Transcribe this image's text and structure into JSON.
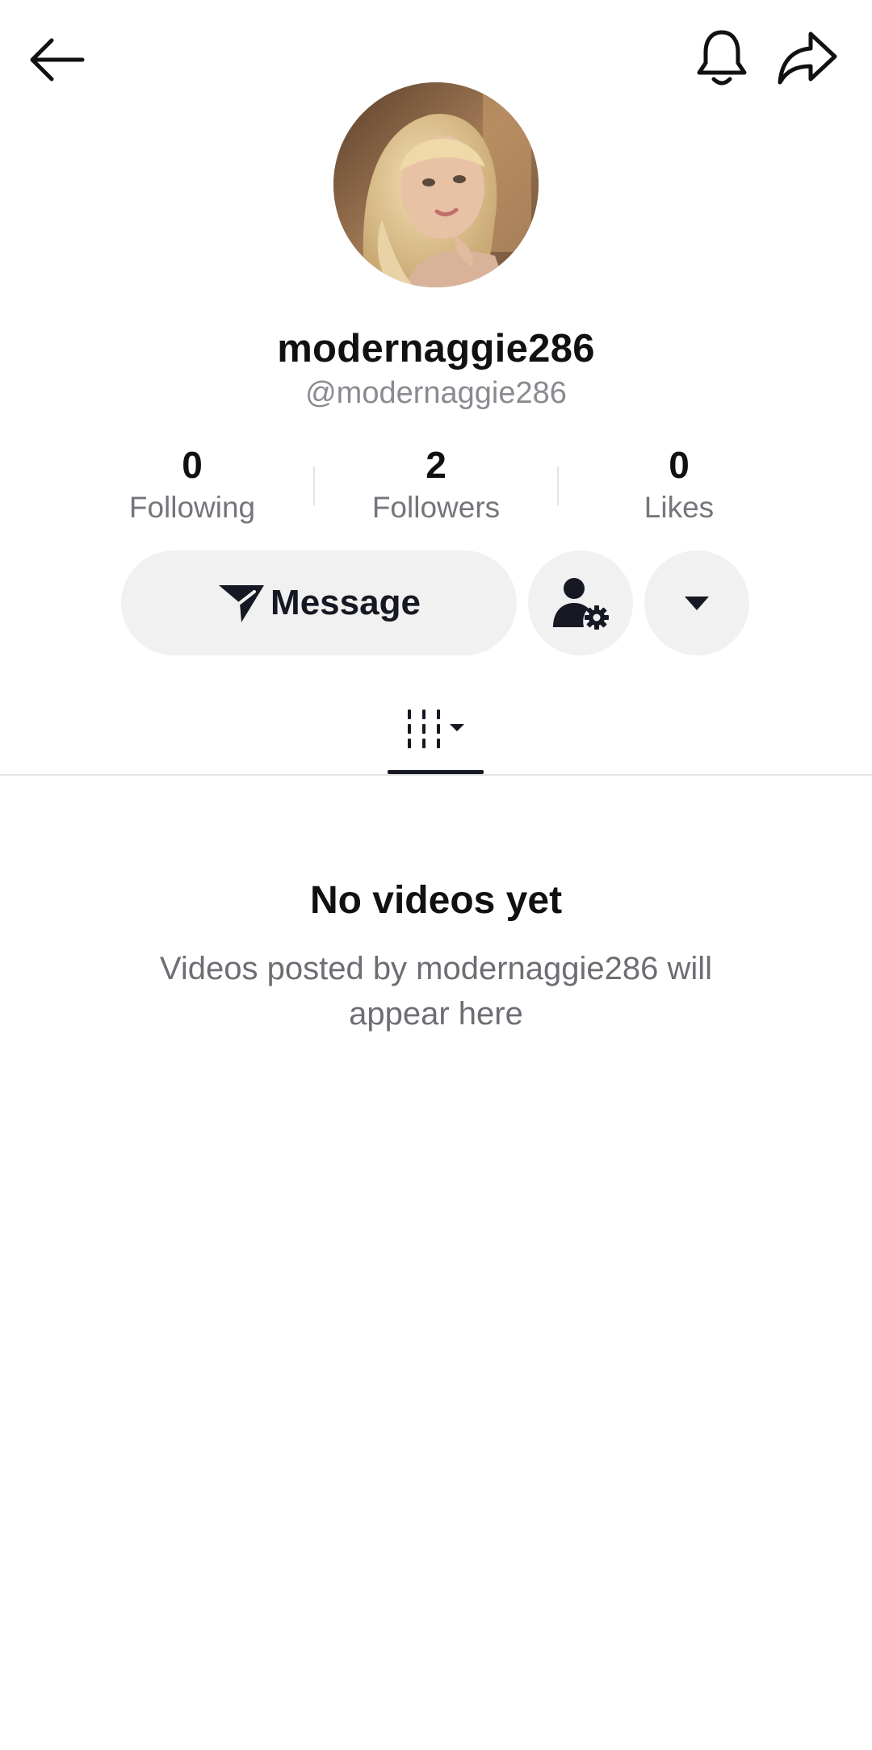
{
  "header": {
    "back_icon": "arrow-left-icon",
    "notification_icon": "bell-icon",
    "share_icon": "share-arrow-icon"
  },
  "profile": {
    "display_name": "modernaggie286",
    "handle": "@modernaggie286",
    "avatar": "profile-photo"
  },
  "stats": {
    "following": {
      "value": "0",
      "label": "Following"
    },
    "followers": {
      "value": "2",
      "label": "Followers"
    },
    "likes": {
      "value": "0",
      "label": "Likes"
    }
  },
  "actions": {
    "message_label": "Message",
    "message_icon": "send-icon",
    "friend_settings_icon": "person-gear-icon",
    "more_icon": "caret-down-icon"
  },
  "tabs": {
    "videos_icon": "grid-columns-icon"
  },
  "empty_state": {
    "title": "No videos yet",
    "description": "Videos posted by modernaggie286 will appear here"
  },
  "colors": {
    "text_primary": "#111111",
    "text_secondary": "#8a8b91",
    "button_bg": "#f1f1f2",
    "divider": "#e5e5e7"
  }
}
